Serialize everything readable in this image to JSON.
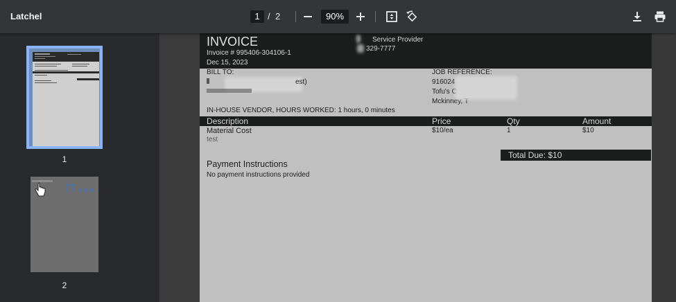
{
  "app_title": "Latchel",
  "pager": {
    "current": "1",
    "separator": "/",
    "total": "2"
  },
  "zoom": "90%",
  "icons": {
    "zoom_out": "minus-icon",
    "zoom_in": "plus-icon",
    "fit": "fit-page-icon",
    "rotate": "rotate-icon",
    "download": "download-icon",
    "print": "print-icon"
  },
  "thumbnails": [
    {
      "label": "1"
    },
    {
      "label": "2"
    }
  ],
  "invoice": {
    "title": "INVOICE",
    "number": "Invoice # 995406-304106-1",
    "date": "Dec 15, 2023",
    "provider_label": "Service Provider",
    "provider_phone": "329-7777",
    "bill_to_label": "BILL TO:",
    "bill_to_name_fragment": "est)",
    "job_reference_label": "JOB REFERENCE:",
    "job_ref_number": "916024",
    "job_ref_place": "Tofu's C",
    "job_ref_city": "Mckinney, T",
    "vendor_line": "IN-HOUSE VENDOR, HOURS WORKED: 1 hours, 0 minutes",
    "columns": {
      "description": "Description",
      "price": "Price",
      "qty": "Qty",
      "amount": "Amount"
    },
    "items": [
      {
        "description": "Material Cost",
        "note": "test",
        "price": "$10/ea",
        "qty": "1",
        "amount": "$10"
      }
    ],
    "total_due": "Total Due: $10",
    "payment_title": "Payment Instructions",
    "payment_text": "No payment instructions provided"
  },
  "colors": {
    "toolbar": "#323639",
    "sidebar": "#282a2d",
    "viewer": "#3b3b3b",
    "page": "#c0c0c0",
    "invoice_dark": "#1c1d1d",
    "thumb_selected_border": "#8ab4f8"
  }
}
